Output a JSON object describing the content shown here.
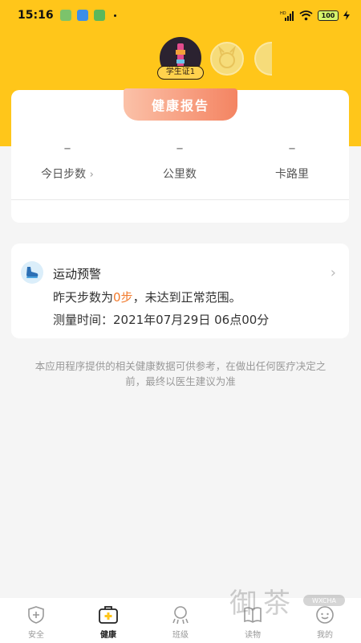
{
  "status_bar": {
    "time": "15:16",
    "battery": "100",
    "network": "HD"
  },
  "avatars": {
    "main_label": "学生证1"
  },
  "report": {
    "title": "健康报告",
    "stats": [
      {
        "value": "–",
        "label": "今日步数",
        "has_chevron": true
      },
      {
        "value": "–",
        "label": "公里数",
        "has_chevron": false
      },
      {
        "value": "–",
        "label": "卡路里",
        "has_chevron": false
      }
    ]
  },
  "alert": {
    "title": "运动预警",
    "line1_prefix": "昨天步数为",
    "line1_highlight": "0步",
    "line1_suffix": "，未达到正常范围。",
    "line2": "测量时间：2021年07月29日 06点00分"
  },
  "disclaimer": "本应用程序提供的相关健康数据可供参考，在做出任何医疗决定之前，最终以医生建议为准",
  "tabbar": [
    {
      "label": "安全",
      "icon": "shield-plus-icon",
      "active": false
    },
    {
      "label": "健康",
      "icon": "medical-kit-icon",
      "active": true
    },
    {
      "label": "班级",
      "icon": "class-group-icon",
      "active": false
    },
    {
      "label": "读物",
      "icon": "book-icon",
      "active": false
    },
    {
      "label": "我的",
      "icon": "profile-icon",
      "active": false
    }
  ],
  "watermark": {
    "text": "WXCHA"
  },
  "colors": {
    "brand_yellow": "#ffc61a",
    "highlight_orange": "#f27a2c",
    "report_tab_gradient_end": "#f48462"
  }
}
